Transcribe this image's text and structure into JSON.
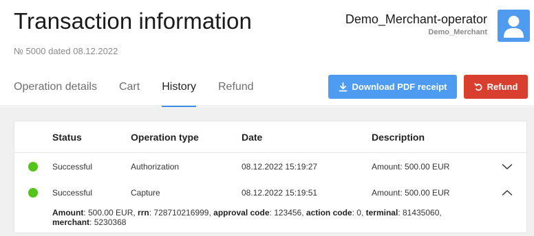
{
  "header": {
    "title": "Transaction information",
    "subtitle": "№ 5000 dated 08.12.2022"
  },
  "user": {
    "name": "Demo_Merchant-operator",
    "org": "Demo_Merchant",
    "avatar_icon": "user-icon",
    "avatar_color": "#4f9bf0"
  },
  "tabs": [
    {
      "label": "Operation details",
      "active": false
    },
    {
      "label": "Cart",
      "active": false
    },
    {
      "label": "History",
      "active": true
    },
    {
      "label": "Refund",
      "active": false
    }
  ],
  "actions": {
    "pdf_label": "Download PDF receipt",
    "pdf_icon": "download-icon",
    "pdf_color": "#4d9cf1",
    "refund_label": "Refund",
    "refund_icon": "undo-icon",
    "refund_color": "#d93f2f"
  },
  "table": {
    "columns": [
      "Status",
      "Operation type",
      "Date",
      "Description"
    ],
    "rows": [
      {
        "status": "Successful",
        "type": "Authorization",
        "date": "08.12.2022 15:19:27",
        "description": "Amount: 500.00 EUR",
        "expanded": false,
        "status_color": "#52c41a"
      },
      {
        "status": "Successful",
        "type": "Capture",
        "date": "08.12.2022 15:19:51",
        "description": "Amount: 500.00 EUR",
        "expanded": true,
        "status_color": "#52c41a"
      }
    ],
    "details": [
      {
        "key": "Amount",
        "value": "500.00 EUR"
      },
      {
        "key": "rrn",
        "value": "728710216999"
      },
      {
        "key": "approval code",
        "value": "123456"
      },
      {
        "key": "action code",
        "value": "0"
      },
      {
        "key": "terminal",
        "value": "81435060"
      },
      {
        "key": "merchant",
        "value": "5230368"
      }
    ]
  }
}
